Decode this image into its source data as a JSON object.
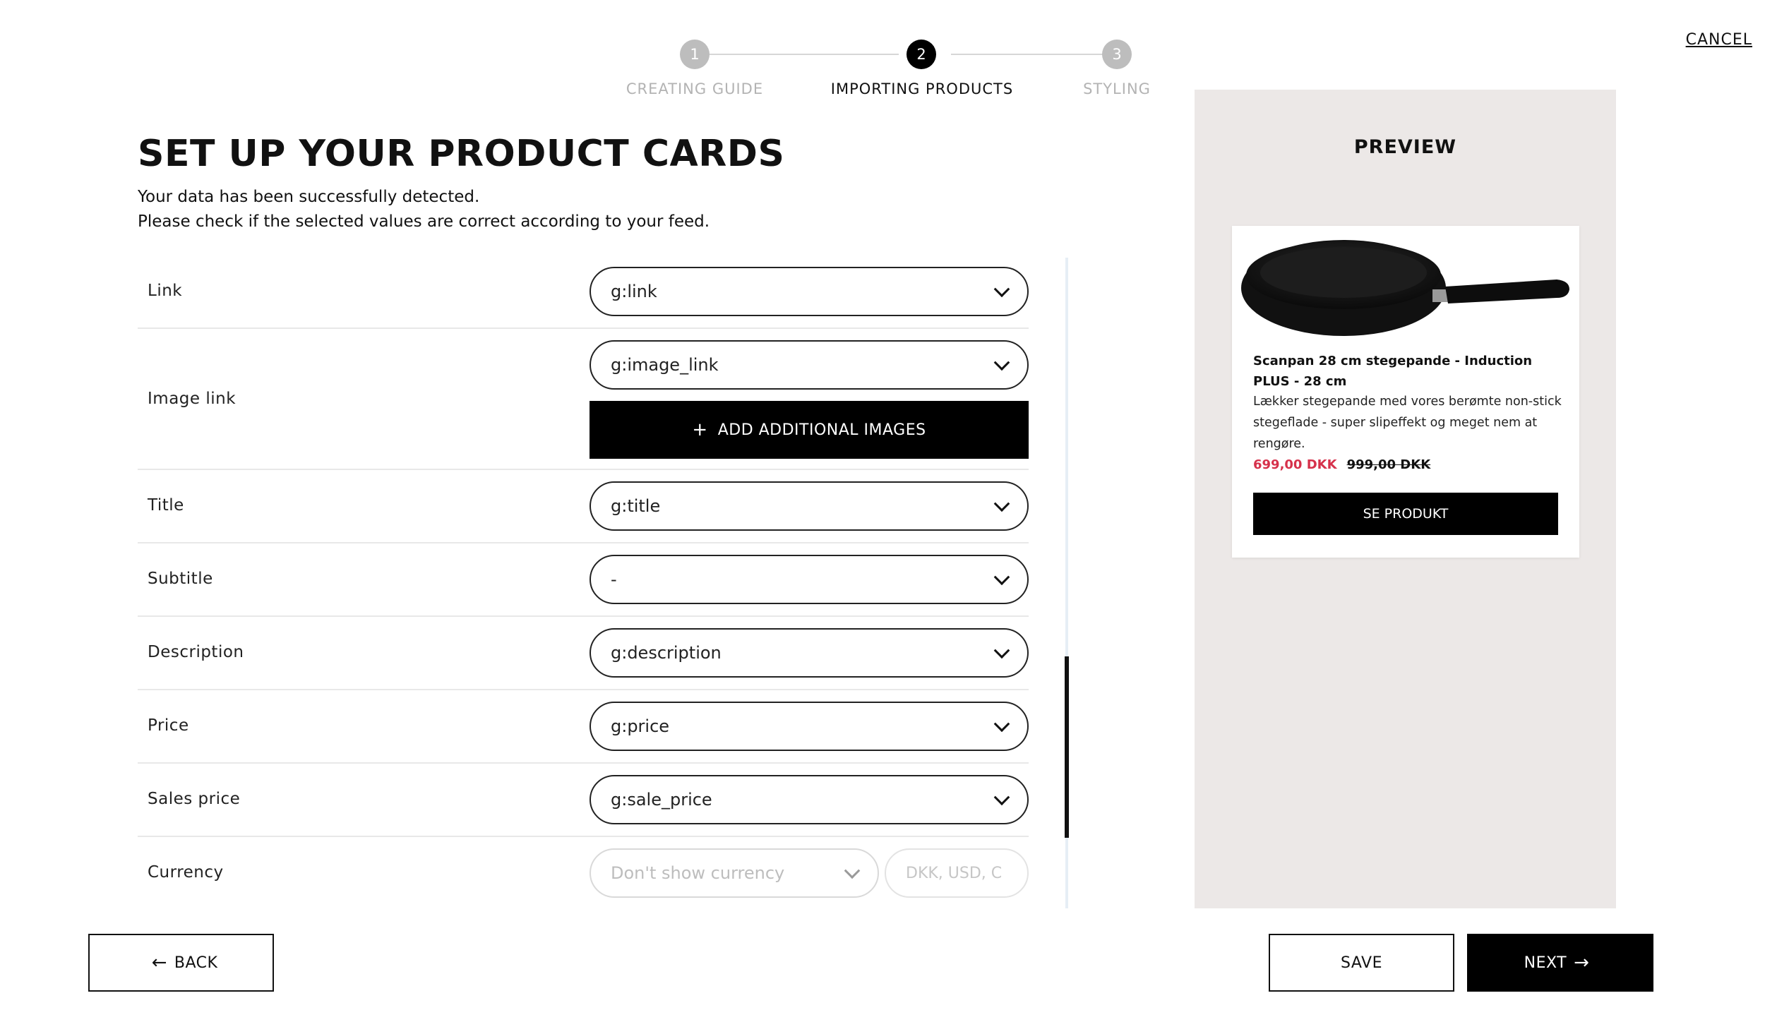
{
  "stepper": {
    "steps": [
      {
        "number": "1",
        "label": "CREATING GUIDE",
        "state": "inactive"
      },
      {
        "number": "2",
        "label": "IMPORTING PRODUCTS",
        "state": "active"
      },
      {
        "number": "3",
        "label": "STYLING",
        "state": "inactive"
      }
    ]
  },
  "header": {
    "cancel_label": "CANCEL"
  },
  "main": {
    "title": "SET UP YOUR PRODUCT CARDS",
    "intro_line1": "Your data has been successfully detected.",
    "intro_line2": "Please check if the selected values are correct according to your feed."
  },
  "fields": {
    "link": {
      "label": "Link",
      "value": "g:link"
    },
    "image_link": {
      "label": "Image link",
      "value": "g:image_link",
      "add_button": "ADD ADDITIONAL IMAGES",
      "add_icon": "+"
    },
    "title": {
      "label": "Title",
      "value": "g:title"
    },
    "subtitle": {
      "label": "Subtitle",
      "value": "-"
    },
    "description": {
      "label": "Description",
      "value": "g:description"
    },
    "price": {
      "label": "Price",
      "value": "g:price"
    },
    "sales_price": {
      "label": "Sales price",
      "value": "g:sale_price"
    },
    "currency": {
      "label": "Currency",
      "value": "Don't show currency",
      "placeholder": "DKK, USD, C"
    }
  },
  "preview": {
    "heading": "PREVIEW",
    "card": {
      "title": "Scanpan 28 cm stegepande - Induction PLUS - 28 cm",
      "description": "Lækker stegepande med vores berømte non-stick stegeflade - super slipeffekt og meget nem at rengøre.",
      "sale_price": "699,00 DKK",
      "old_price": "999,00 DKK",
      "button": "SE PRODUKT"
    },
    "colors": {
      "sale_price": "#d6314b",
      "panel_bg": "#ece8e7"
    }
  },
  "footer": {
    "back_label": "BACK",
    "back_icon": "arrow-left-icon",
    "save_label": "SAVE",
    "next_label": "NEXT",
    "next_icon": "arrow-right-icon"
  }
}
